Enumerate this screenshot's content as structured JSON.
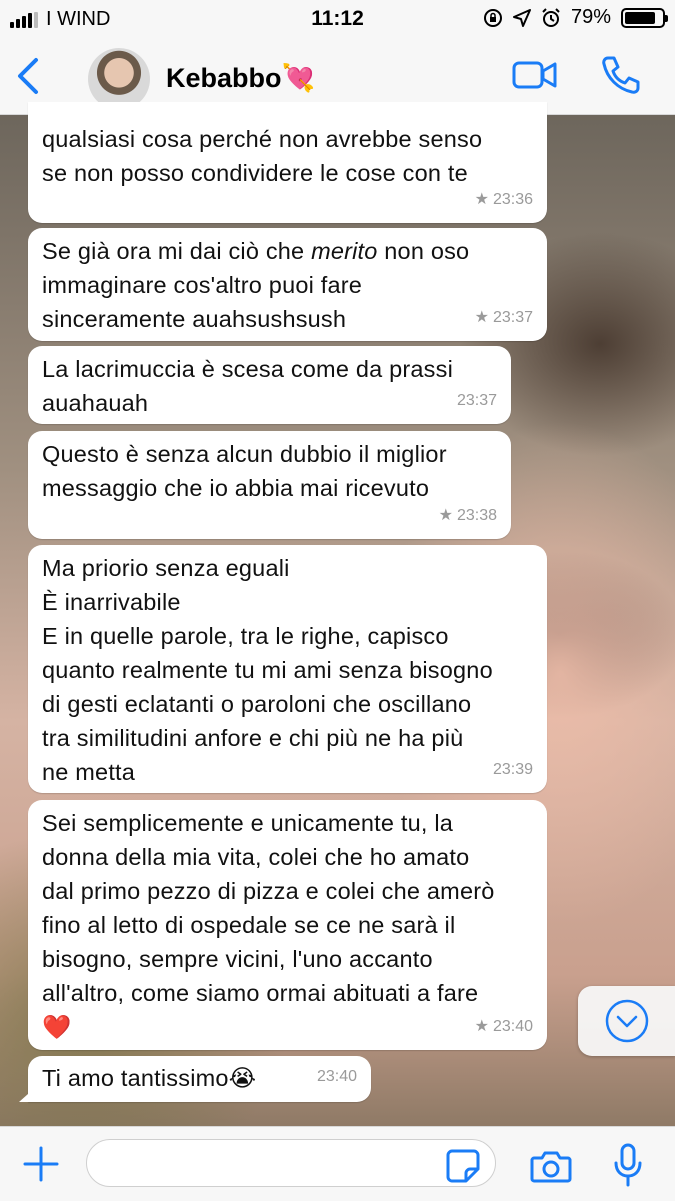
{
  "status_bar": {
    "carrier": "I WIND",
    "time": "11:12",
    "battery": "79%",
    "battery_level": 0.79
  },
  "header": {
    "contact_name": "Kebabbo💘"
  },
  "messages": [
    {
      "text": "qualsiasi cosa perché non avrebbe senso\nse non posso condividere le cose con te",
      "time": "23:36",
      "starred": true
    },
    {
      "text": "Se già ora mi dai ciò che merito non oso\nimmaginare cos'altro puoi fare\nsinceramente auahsushsush",
      "time": "23:37",
      "starred": true
    },
    {
      "text": "La lacrimuccia è scesa come da prassi\nauahauah",
      "time": "23:37",
      "starred": false
    },
    {
      "text": "Questo è senza alcun dubbio il miglior\nmessaggio che io abbia mai ricevuto",
      "time": "23:38",
      "starred": true
    },
    {
      "text": "Ma priorio senza eguali\nÈ inarrivabile\nE in quelle parole, tra le righe, capisco\nquanto realmente tu mi ami senza bisogno\ndi gesti eclatanti o paroloni che oscillano\ntra similitudini anfore e chi più ne ha più\nne metta",
      "time": "23:39",
      "starred": false
    },
    {
      "text": "Sei semplicemente e unicamente tu, la\ndonna della mia vita, colei che ho amato\ndal primo pezzo di pizza e colei che amerò\nfino al letto di ospedale se ce ne sarà il\nbisogno, sempre vicini, l'uno accanto\nall'altro, come siamo ormai abituati a fare\n❤️",
      "time": "23:40",
      "starred": true
    },
    {
      "text": "Ti amo tantissimo😭",
      "time": "23:40",
      "starred": false
    }
  ],
  "message_1_parts": {
    "before": "Se già ora mi dai ciò che ",
    "italic": "merito",
    "after": " non oso\nimmaginare cos'altro puoi fare\nsinceramente auahsushsush"
  },
  "star_glyph": "★",
  "input": {
    "placeholder": ""
  },
  "icons": {
    "back": "chevron-left-icon",
    "video": "video-camera-icon",
    "call": "phone-icon",
    "scroll": "chevron-down-circle-icon",
    "plus": "plus-icon",
    "sticker": "sticker-icon",
    "camera": "camera-icon",
    "mic": "microphone-icon"
  },
  "colors": {
    "accent": "#1a7cf6",
    "bubble": "#ffffff",
    "meta": "#9a9a9a"
  }
}
